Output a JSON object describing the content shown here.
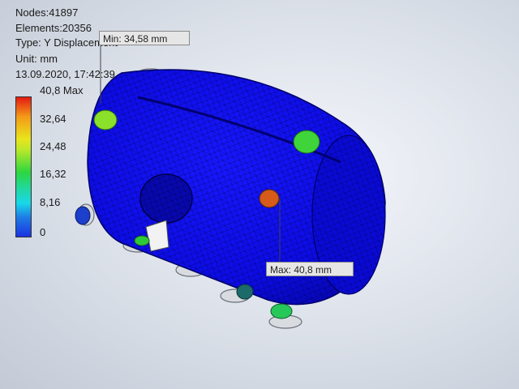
{
  "header": {
    "nodes": "Nodes:41897",
    "elements": "Elements:20356",
    "type": "Type: Y Displacement",
    "unit": "Unit: mm",
    "timestamp": "13.09.2020, 17:42:39"
  },
  "legend": {
    "max_label": "40,8 Max",
    "ticks": [
      "32,64",
      "24,48",
      "16,32",
      "8,16",
      "0"
    ],
    "colors": {
      "high": "#e41a12",
      "mid": "#2cd640",
      "low": "#1a33e0"
    }
  },
  "callouts": {
    "min": "Min: 34,58 mm",
    "max": "Max: 40,8 mm"
  },
  "model": {
    "body_color": "#1010e0",
    "mesh_color": "#000060"
  }
}
